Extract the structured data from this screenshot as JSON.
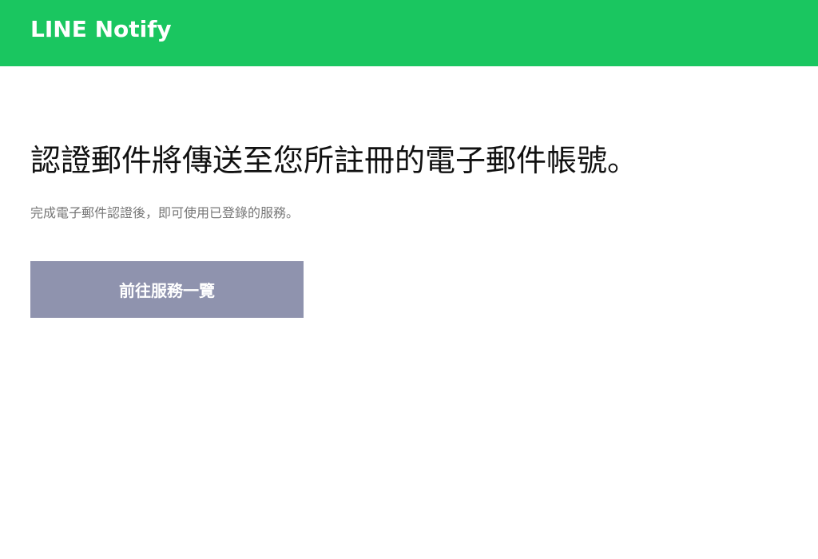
{
  "header": {
    "logo_text": "LINE Notify"
  },
  "main": {
    "headline": "認證郵件將傳送至您所註冊的電子郵件帳號。",
    "subtext": "完成電子郵件認證後，即可使用已登錄的服務。",
    "button_label": "前往服務一覽"
  },
  "colors": {
    "brand_green": "#1ac660",
    "button_bg": "#8f93ae"
  }
}
